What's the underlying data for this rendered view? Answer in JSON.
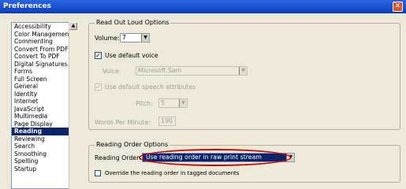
{
  "window": {
    "title": "Preferences",
    "close_glyph": "✕"
  },
  "sidebar": {
    "items": [
      {
        "label": "Accessibility",
        "selected": false
      },
      {
        "label": "Color Management",
        "selected": false
      },
      {
        "label": "Commenting",
        "selected": false
      },
      {
        "label": "Convert From PDF",
        "selected": false
      },
      {
        "label": "Convert To PDF",
        "selected": false
      },
      {
        "label": "Digital Signatures",
        "selected": false
      },
      {
        "label": "Forms",
        "selected": false
      },
      {
        "label": "Full Screen",
        "selected": false
      },
      {
        "label": "General",
        "selected": false
      },
      {
        "label": "Identity",
        "selected": false
      },
      {
        "label": "Internet",
        "selected": false
      },
      {
        "label": "JavaScript",
        "selected": false
      },
      {
        "label": "Multimedia",
        "selected": false
      },
      {
        "label": "Page Display",
        "selected": false
      },
      {
        "label": "Reading",
        "selected": true
      },
      {
        "label": "Reviewing",
        "selected": false
      },
      {
        "label": "Search",
        "selected": false
      },
      {
        "label": "Smoothing",
        "selected": false
      },
      {
        "label": "Spelling",
        "selected": false
      },
      {
        "label": "Startup",
        "selected": false
      }
    ],
    "scroll_up_glyph": "▲"
  },
  "read_out_loud": {
    "legend": "Read Out Loud Options",
    "volume_label": "Volume:",
    "volume_value": "7",
    "use_default_voice_label": "Use default voice",
    "use_default_voice_checked": true,
    "use_default_voice_check": "✓",
    "voice_label": "Voice:",
    "voice_value": "Microsoft Sam",
    "use_default_speech_label": "Use default speech attributes",
    "use_default_speech_checked": true,
    "use_default_speech_check": "✓",
    "pitch_label": "Pitch:",
    "pitch_value": "5",
    "wpm_label": "Words Per Minute:",
    "wpm_value": "190"
  },
  "reading_order": {
    "legend": "Reading Order Options",
    "reading_order_label": "Reading Order:",
    "reading_order_value": "Use reading order in raw print stream",
    "override_label": "Override the reading order in tagged documents",
    "override_checked": false
  },
  "dropdown_glyph": "▼"
}
